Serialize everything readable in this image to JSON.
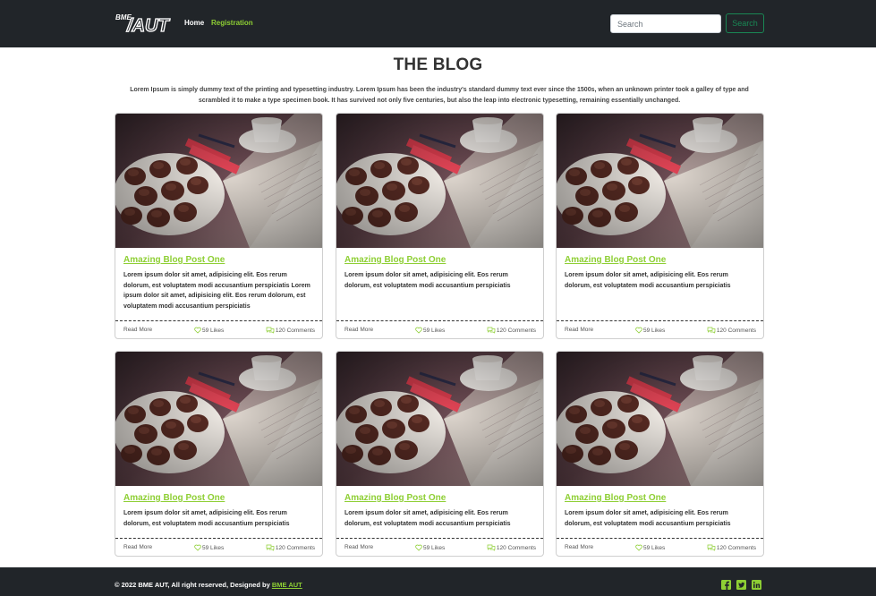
{
  "nav": {
    "logo_text": "BME AUT",
    "home": "Home",
    "registration": "Registration",
    "search_placeholder": "Search",
    "search_button": "Search"
  },
  "page": {
    "title": "THE BLOG",
    "intro": "Lorem Ipsum is simply dummy text of the printing and typesetting industry. Lorem Ipsum has been the industry's standard dummy text ever since the 1500s, when an unknown printer took a galley of type and scrambled it to make a type specimen book. It has survived not only five centuries, but also the leap into electronic typesetting, remaining essentially unchanged."
  },
  "cards": [
    {
      "title": "Amazing Blog Post One",
      "text": "Lorem ipsum dolor sit amet, adipisicing elit. Eos rerum dolorum, est voluptatem modi accusantium perspiciatis Lorem ipsum dolor sit amet, adipisicing elit. Eos rerum dolorum, est voluptatem modi accusantium perspiciatis",
      "read_more": "Read More",
      "likes": "59 Likes",
      "comments": "120 Comments"
    },
    {
      "title": "Amazing Blog Post One",
      "text": "Lorem ipsum dolor sit amet, adipisicing elit. Eos rerum dolorum, est voluptatem modi accusantium perspiciatis",
      "read_more": "Read More",
      "likes": "59 Likes",
      "comments": "120 Comments"
    },
    {
      "title": "Amazing Blog Post One",
      "text": "Lorem ipsum dolor sit amet, adipisicing elit. Eos rerum dolorum, est voluptatem modi accusantium perspiciatis",
      "read_more": "Read More",
      "likes": "59 Likes",
      "comments": "120 Comments"
    },
    {
      "title": "Amazing Blog Post One",
      "text": "Lorem ipsum dolor sit amet, adipisicing elit. Eos rerum dolorum, est voluptatem modi accusantium perspiciatis",
      "read_more": "Read More",
      "likes": "59 Likes",
      "comments": "120 Comments"
    },
    {
      "title": "Amazing Blog Post One",
      "text": "Lorem ipsum dolor sit amet, adipisicing elit. Eos rerum dolorum, est voluptatem modi accusantium perspiciatis",
      "read_more": "Read More",
      "likes": "59 Likes",
      "comments": "120 Comments"
    },
    {
      "title": "Amazing Blog Post One",
      "text": "Lorem ipsum dolor sit amet, adipisicing elit. Eos rerum dolorum, est voluptatem modi accusantium perspiciatis",
      "read_more": "Read More",
      "likes": "59 Likes",
      "comments": "120 Comments"
    }
  ],
  "footer": {
    "copyright": "© 2022 BME AUT, All right reserved, Designed by",
    "designer": "BME AUT",
    "social": [
      "facebook-icon",
      "twitter-icon",
      "linkedin-icon"
    ]
  },
  "colors": {
    "accent": "#8ecf34",
    "dark": "#212529",
    "success": "#198754"
  }
}
